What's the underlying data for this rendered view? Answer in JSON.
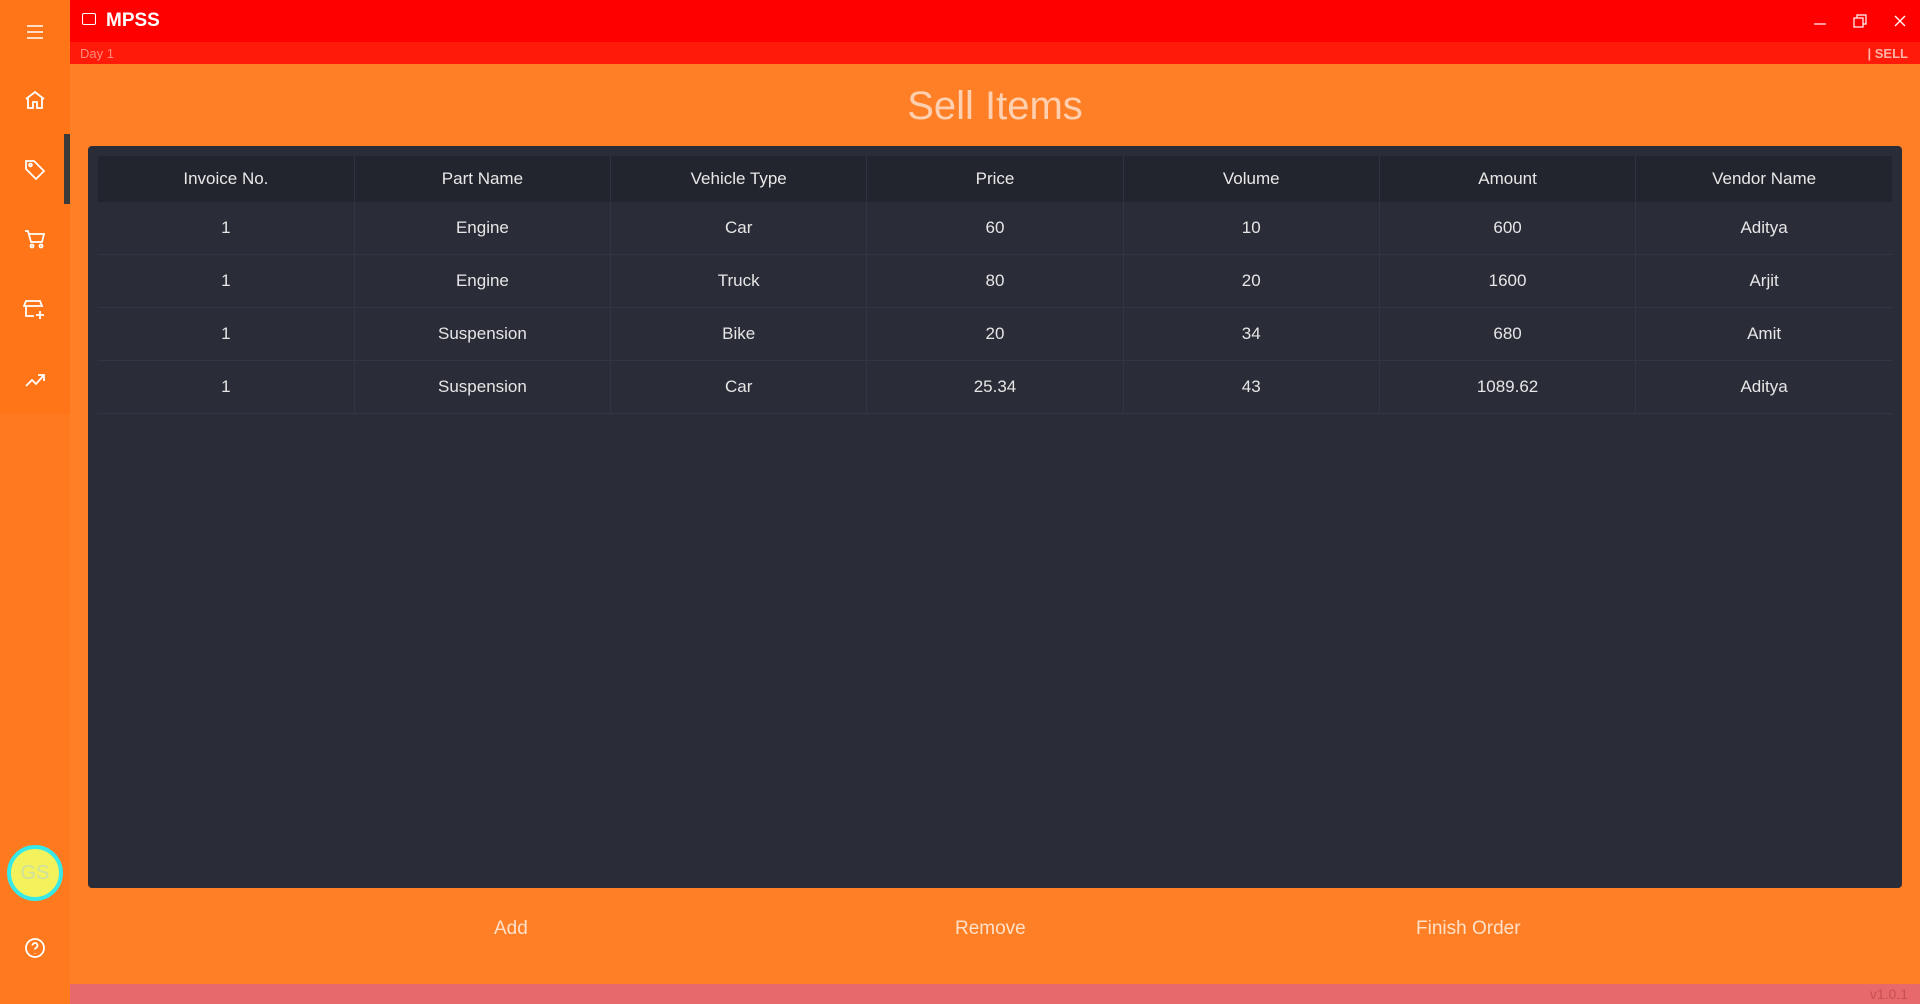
{
  "app": {
    "title": "MPSS",
    "day": "Day 1",
    "mode": "| SELL",
    "version": "v1.0.1"
  },
  "user": {
    "initials": "GS"
  },
  "page": {
    "title": "Sell Items"
  },
  "table": {
    "columns": [
      "Invoice No.",
      "Part Name",
      "Vehicle Type",
      "Price",
      "Volume",
      "Amount",
      "Vendor Name"
    ],
    "rows": [
      [
        "1",
        "Engine",
        "Car",
        "60",
        "10",
        "600",
        "Aditya"
      ],
      [
        "1",
        "Engine",
        "Truck",
        "80",
        "20",
        "1600",
        "Arjit"
      ],
      [
        "1",
        "Suspension",
        "Bike",
        "20",
        "34",
        "680",
        "Amit"
      ],
      [
        "1",
        "Suspension",
        "Car",
        "25.34",
        "43",
        "1089.62",
        "Aditya"
      ]
    ]
  },
  "actions": {
    "add": "Add",
    "remove": "Remove",
    "finish": "Finish Order"
  },
  "sidebar": {
    "items": [
      {
        "icon": "menu-icon"
      },
      {
        "icon": "home-icon"
      },
      {
        "icon": "tag-icon",
        "active": true
      },
      {
        "icon": "cart-icon"
      },
      {
        "icon": "store-add-icon"
      },
      {
        "icon": "analytics-icon"
      },
      {
        "icon": "help-icon"
      }
    ]
  },
  "colors": {
    "titlebar": "#ff0000",
    "background": "#ff7f27",
    "panel": "#2a2d38"
  }
}
